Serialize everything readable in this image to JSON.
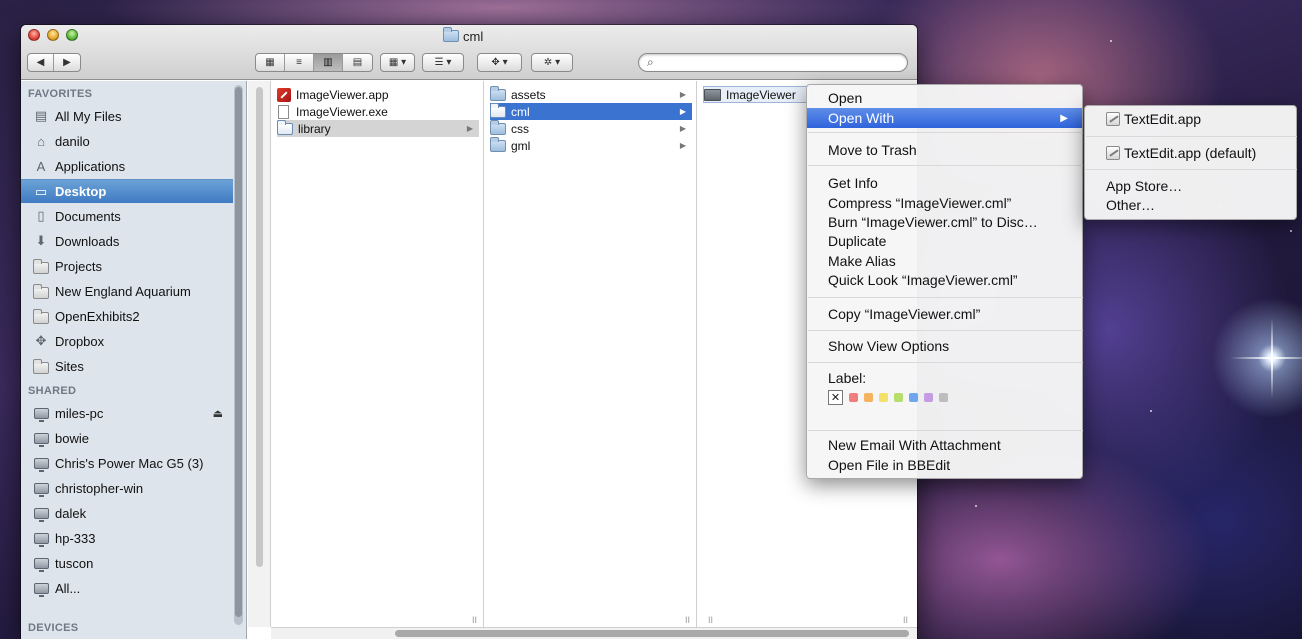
{
  "window": {
    "title": "cml",
    "nav_back": "◀",
    "nav_forward": "▶",
    "view_icons": "▦",
    "view_list": "≡",
    "view_columns": "▥",
    "view_coverflow": "▤",
    "arrange_label": "▦ ▾",
    "sort_label": "☰ ▾",
    "dropbox_label": "✥ ▾",
    "action_label": "✲ ▾",
    "search_placeholder": "",
    "search_icon": "⌕"
  },
  "sidebar": {
    "favorites_header": "FAVORITES",
    "favorites": [
      {
        "label": "All My Files",
        "icon": "all-files-icon",
        "glyph": "▤"
      },
      {
        "label": "danilo",
        "icon": "home-icon",
        "glyph": "⌂"
      },
      {
        "label": "Applications",
        "icon": "applications-icon",
        "glyph": "A"
      },
      {
        "label": "Desktop",
        "icon": "desktop-icon",
        "glyph": "▭",
        "selected": true
      },
      {
        "label": "Documents",
        "icon": "documents-icon",
        "glyph": "▯"
      },
      {
        "label": "Downloads",
        "icon": "downloads-icon",
        "glyph": "⬇"
      },
      {
        "label": "Projects",
        "icon": "folder-icon"
      },
      {
        "label": "New England Aquarium",
        "icon": "folder-icon"
      },
      {
        "label": "OpenExhibits2",
        "icon": "folder-icon"
      },
      {
        "label": "Dropbox",
        "icon": "dropbox-icon",
        "glyph": "✥"
      },
      {
        "label": "Sites",
        "icon": "folder-icon"
      }
    ],
    "shared_header": "SHARED",
    "shared": [
      {
        "label": "miles-pc",
        "eject": "⏏"
      },
      {
        "label": "bowie"
      },
      {
        "label": "Chris's Power Mac G5 (3)"
      },
      {
        "label": "christopher-win"
      },
      {
        "label": "dalek"
      },
      {
        "label": "hp-333"
      },
      {
        "label": "tuscon"
      },
      {
        "label": "All..."
      }
    ],
    "devices_header": "DEVICES"
  },
  "columns": {
    "col1": [
      {
        "label": "ImageViewer.app",
        "type": "app"
      },
      {
        "label": "ImageViewer.exe",
        "type": "doc"
      },
      {
        "label": "library",
        "type": "folder",
        "has_children": true,
        "highlight": true
      }
    ],
    "col2": [
      {
        "label": "assets",
        "has_children": true
      },
      {
        "label": "cml",
        "has_children": true,
        "selected": true
      },
      {
        "label": "css",
        "has_children": true
      },
      {
        "label": "gml",
        "has_children": true
      }
    ],
    "col3": [
      {
        "label": "ImageViewer"
      }
    ],
    "resize_glyph": "II",
    "arrow_glyph": "▶"
  },
  "context_menu": {
    "open": "Open",
    "open_with": "Open With",
    "submenu_arrow": "▶",
    "move_to_trash": "Move to Trash",
    "get_info": "Get Info",
    "compress": "Compress “ImageViewer.cml”",
    "burn": "Burn “ImageViewer.cml” to Disc…",
    "duplicate": "Duplicate",
    "make_alias": "Make Alias",
    "quick_look": "Quick Look “ImageViewer.cml”",
    "copy": "Copy “ImageViewer.cml”",
    "show_view_options": "Show View Options",
    "label_title": "Label:",
    "label_none": "✕",
    "label_colors": [
      "#f27d7d",
      "#f5b25f",
      "#f4e16a",
      "#b7dd6d",
      "#6ea7ef",
      "#c59be1",
      "#bdbdbd"
    ],
    "new_email": "New Email With Attachment",
    "open_in_bbedit": "Open File in BBEdit"
  },
  "open_with_submenu": {
    "textedit": "TextEdit.app",
    "textedit_default": "TextEdit.app (default)",
    "app_store": "App Store…",
    "other": "Other…"
  },
  "colors": {
    "selection_blue": "#3b74d0",
    "menu_highlight": "#2f63db",
    "sidebar_bg": "#dde4eb"
  }
}
